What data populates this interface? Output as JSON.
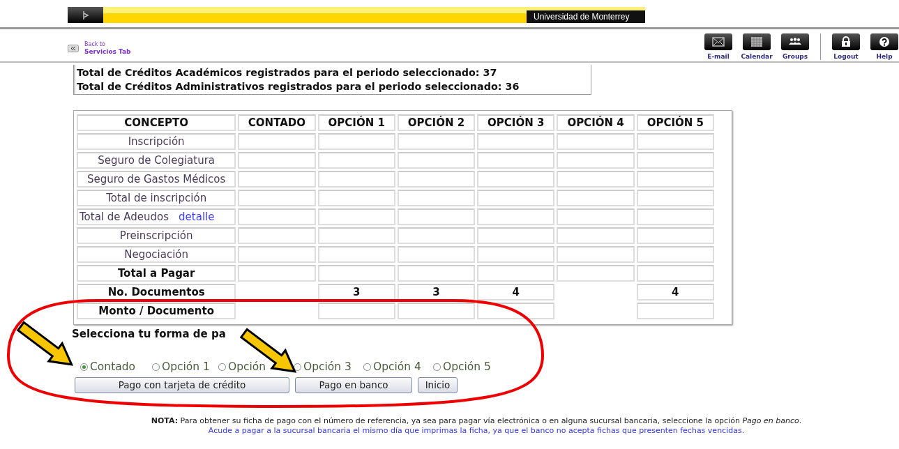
{
  "banner": {
    "title": "Universidad de Monterrey"
  },
  "back_link": {
    "line_1": "Back to",
    "line_2": "Servicios Tab"
  },
  "toolbar": [
    {
      "kind": "mail",
      "label": "E-mail"
    },
    {
      "kind": "calendar",
      "label": "Calendar"
    },
    {
      "kind": "groups",
      "label": "Groups"
    },
    {
      "kind": "separator"
    },
    {
      "kind": "lock",
      "label": "Logout"
    },
    {
      "kind": "help",
      "label": "Help"
    }
  ],
  "credits": [
    "Total de Créditos Académicos registrados para el periodo seleccionado: 37",
    "Total de Créditos Administrativos registrados para el periodo seleccionado: 36"
  ],
  "table": {
    "columns": [
      "CONCEPTO",
      "CONTADO",
      "OPCIÓN 1",
      "OPCIÓN 2",
      "OPCIÓN 3",
      "OPCIÓN 4",
      "OPCIÓN 5"
    ],
    "rows": [
      {
        "kind": "item",
        "cells": [
          {
            "text": "Inscripción"
          },
          {},
          {},
          {},
          {},
          {},
          {}
        ]
      },
      {
        "kind": "item",
        "cells": [
          {
            "text": "Seguro de Colegiatura"
          },
          {},
          {},
          {},
          {},
          {},
          {}
        ]
      },
      {
        "kind": "item",
        "cells": [
          {
            "text": "Seguro de Gastos Médicos"
          },
          {},
          {},
          {},
          {},
          {},
          {}
        ]
      },
      {
        "kind": "item",
        "cells": [
          {
            "text": "Total de inscripción"
          },
          {},
          {},
          {},
          {},
          {},
          {}
        ]
      },
      {
        "kind": "item",
        "cells": [
          {
            "text": "Total de Adeudos",
            "link": "detalle"
          },
          {},
          {},
          {},
          {},
          {},
          {}
        ]
      },
      {
        "kind": "item",
        "cells": [
          {
            "text": "Preinscripción"
          },
          {},
          {},
          {},
          {},
          {},
          {}
        ]
      },
      {
        "kind": "item",
        "cells": [
          {
            "text": "Negociación"
          },
          {},
          {},
          {},
          {},
          {},
          {}
        ]
      },
      {
        "kind": "total",
        "cells": [
          {
            "text": "Total a Pagar"
          },
          {},
          {},
          {},
          {},
          {},
          {}
        ]
      },
      {
        "kind": "total",
        "cells": [
          {
            "text": "No. Documentos"
          },
          null,
          {
            "text": "3"
          },
          {
            "text": "3"
          },
          {
            "text": "4"
          },
          null,
          {
            "text": "4"
          }
        ]
      },
      {
        "kind": "total",
        "cells": [
          {
            "text": "Monto / Documento"
          },
          null,
          {},
          {},
          {},
          null,
          {}
        ]
      }
    ]
  },
  "payment": {
    "prompt": "Selecciona tu forma de pa",
    "options": [
      {
        "label": "Contado",
        "selected": true
      },
      {
        "label": "Opción 1",
        "selected": false
      },
      {
        "label": "Opción",
        "selected": false
      },
      {
        "label": "Opción 3",
        "selected": false
      },
      {
        "label": "Opción 4",
        "selected": false
      },
      {
        "label": "Opción 5",
        "selected": false
      }
    ],
    "buttons": [
      "Pago con tarjeta de crédito",
      "Pago en banco",
      "Inicio"
    ]
  },
  "note": {
    "text": "**NOTA:** Para obtener su ficha de pago con el número de referencia, ya sea para pagar vía electrónica o en alguna sucursal bancaria, seleccione la opción *Pago en banco*.",
    "reminder": "Acude a pagar a la sucursal bancaria el mismo día que imprimas la ficha, ya que el banco no acepta fichas que presenten fechas vencidas."
  },
  "annotations": [
    {
      "kind": "ellipse"
    },
    {
      "kind": "arrow"
    },
    {
      "kind": "arrow"
    }
  ]
}
